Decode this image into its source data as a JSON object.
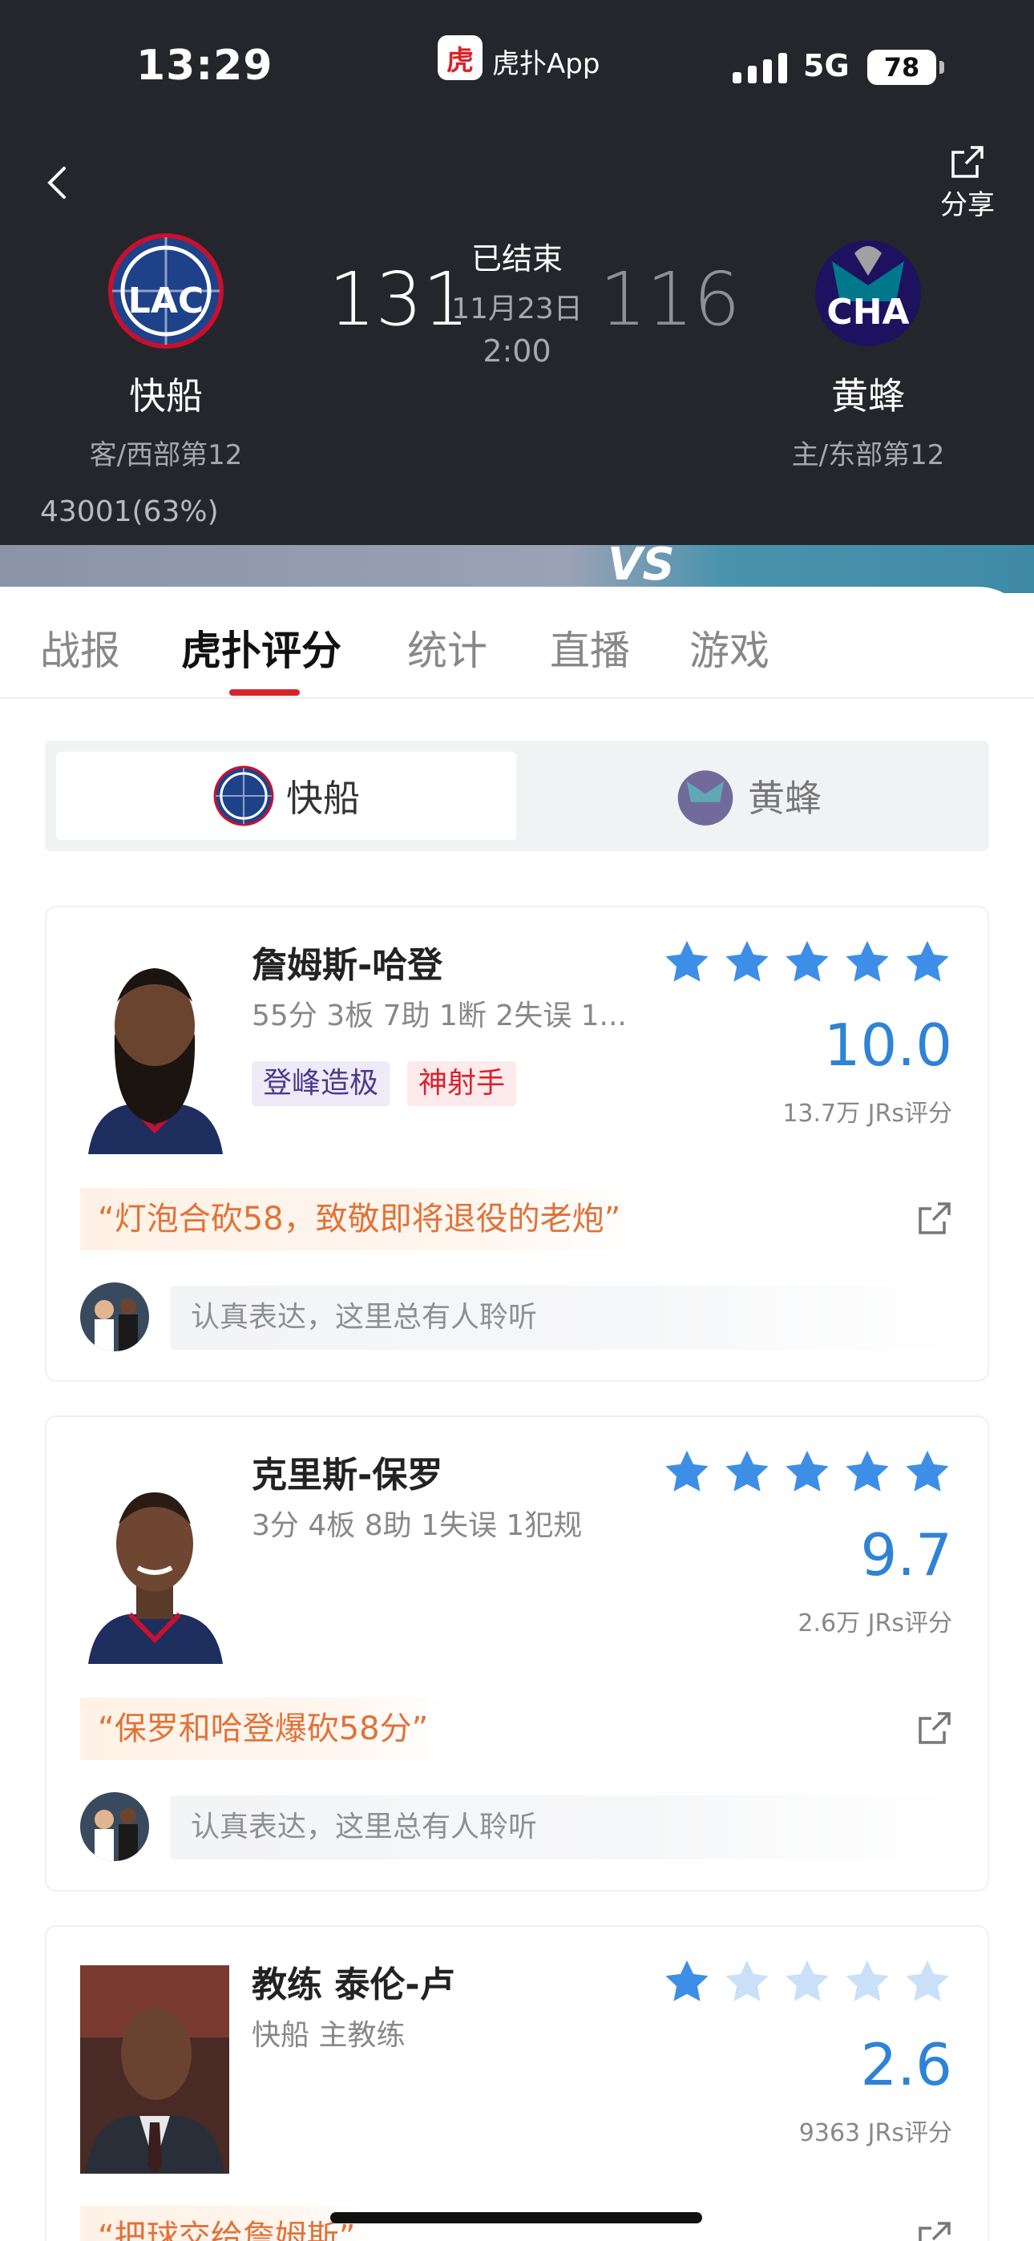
{
  "status_bar": {
    "time": "13:29",
    "app_label": "虎扑App",
    "network": "5G",
    "battery": "78",
    "app_badge_char": "虎"
  },
  "header": {
    "share_label": "分享",
    "status": "已结束",
    "date": "11月23日",
    "time": "2:00",
    "away": {
      "abbr": "LAC",
      "name": "快船",
      "sub": "客/西部第12",
      "score": "131"
    },
    "home": {
      "abbr": "CHA",
      "name": "黄蜂",
      "sub": "主/东部第12",
      "score": "116"
    },
    "support": "43001(63%)",
    "vs": "VS"
  },
  "tabs": [
    {
      "label": "战报"
    },
    {
      "label": "虎扑评分"
    },
    {
      "label": "统计"
    },
    {
      "label": "直播"
    },
    {
      "label": "游戏"
    }
  ],
  "team_switch": {
    "left": "快船",
    "right": "黄蜂"
  },
  "players": [
    {
      "name": "詹姆斯-哈登",
      "stats": "55分 3板 7助 1断 2失误 1...",
      "tags": [
        "登峰造极",
        "神射手"
      ],
      "rating": "10.0",
      "stars": 5,
      "votes": "13.7万 JRs评分",
      "quote": "“灯泡合砍58，致敬即将退役的老炮”",
      "comment_placeholder": "认真表达，这里总有人聆听"
    },
    {
      "name": "克里斯-保罗",
      "stats": "3分 4板 8助 1失误 1犯规",
      "tags": [],
      "rating": "9.7",
      "stars": 5,
      "votes": "2.6万 JRs评分",
      "quote": "“保罗和哈登爆砍58分”",
      "comment_placeholder": "认真表达，这里总有人聆听"
    },
    {
      "name": "教练 泰伦-卢",
      "stats": "快船 主教练",
      "tags": [],
      "rating": "2.6",
      "stars": 1,
      "votes": "9363 JRs评分",
      "quote": "“把球交给詹姆斯”",
      "comment_placeholder": ""
    }
  ],
  "colors": {
    "header_bg": "#25262c",
    "accent_red": "#d8232a",
    "rating_blue": "#2f83d6",
    "star_blue": "#3d8ee6",
    "star_faded": "#c9e0f8",
    "quote_orange": "#e07339"
  }
}
